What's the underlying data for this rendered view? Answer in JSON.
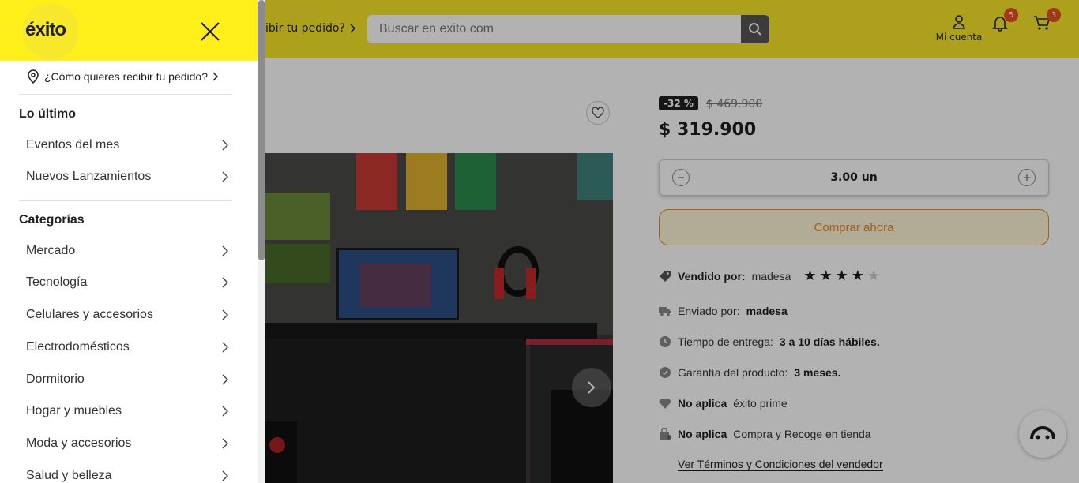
{
  "header": {
    "pickup_text": "ibir tu pedido?",
    "search_placeholder": "Buscar en exito.com",
    "account_label": "Mi cuenta",
    "notifications_count": "5",
    "cart_count": "3"
  },
  "product": {
    "discount": "-32 %",
    "old_price": "$ 469.900",
    "price": "$ 319.900",
    "quantity": "3.00 un",
    "buy_label": "Comprar ahora",
    "sold_by_label": "Vendido por:",
    "sold_by_value": "madesa",
    "rating": 4,
    "rating_max": 5,
    "shipped_by_label": "Enviado por:",
    "shipped_by_value": "madesa",
    "delivery_label": "Tiempo de entrega:",
    "delivery_value": "3 a 10 días hábiles.",
    "warranty_label": "Garantía del producto:",
    "warranty_value": "3 meses.",
    "prime_bold": "No aplica",
    "prime_text": "éxito prime",
    "pickup_bold": "No aplica",
    "pickup_text": "Compra y Recoge en tienda",
    "terms_link": "Ver Términos y Condiciones del vendedor"
  },
  "drawer": {
    "logo_text": "éxito",
    "location_text": "¿Cómo quieres recibir tu pedido?",
    "section_latest": "Lo último",
    "latest_items": [
      "Eventos del mes",
      "Nuevos Lanzamientos"
    ],
    "section_categories": "Categorías",
    "category_items": [
      "Mercado",
      "Tecnología",
      "Celulares y accesorios",
      "Electrodomésticos",
      "Dormitorio",
      "Hogar y muebles",
      "Moda y accesorios",
      "Salud y belleza"
    ]
  },
  "colors": {
    "brand_yellow": "#fff01c",
    "accent_orange": "#e8882a",
    "badge_red": "#e8501a"
  }
}
